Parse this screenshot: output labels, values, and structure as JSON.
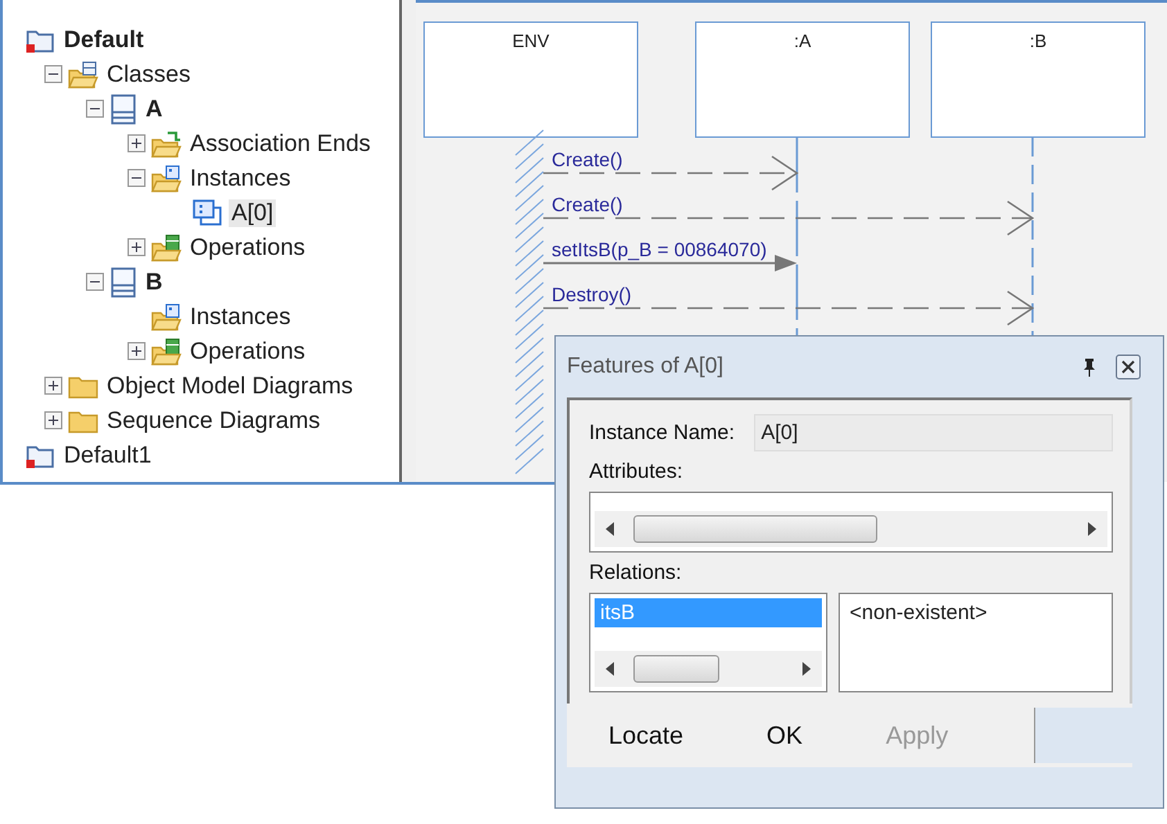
{
  "tree": {
    "items": [
      {
        "label": "Default",
        "kind": "package",
        "bold": true,
        "selected": false,
        "children": [
          {
            "label": "Classes",
            "kind": "classes-folder",
            "bold": false,
            "selected": false,
            "expanded": true,
            "children": [
              {
                "label": "A",
                "kind": "class",
                "bold": true,
                "selected": false,
                "expanded": true,
                "children": [
                  {
                    "label": "Association Ends",
                    "kind": "assoc-folder",
                    "bold": false,
                    "selected": false,
                    "expanded": false
                  },
                  {
                    "label": "Instances",
                    "kind": "instances-folder",
                    "bold": false,
                    "selected": false,
                    "expanded": true,
                    "children": [
                      {
                        "label": "A[0]",
                        "kind": "instance",
                        "bold": false,
                        "selected": true
                      }
                    ]
                  },
                  {
                    "label": "Operations",
                    "kind": "operations-folder",
                    "bold": false,
                    "selected": false,
                    "expanded": false
                  }
                ]
              },
              {
                "label": "B",
                "kind": "class",
                "bold": true,
                "selected": false,
                "expanded": true,
                "children": [
                  {
                    "label": "Instances",
                    "kind": "instances-folder",
                    "bold": false,
                    "selected": false
                  },
                  {
                    "label": "Operations",
                    "kind": "operations-folder",
                    "bold": false,
                    "selected": false,
                    "expanded": false
                  }
                ]
              }
            ]
          },
          {
            "label": "Object Model Diagrams",
            "kind": "folder",
            "bold": false,
            "selected": false,
            "expanded": false
          },
          {
            "label": "Sequence Diagrams",
            "kind": "folder",
            "bold": false,
            "selected": false,
            "expanded": false
          }
        ]
      },
      {
        "label": "Default1",
        "kind": "package",
        "bold": false,
        "selected": false
      }
    ]
  },
  "diagram": {
    "lifelines": [
      {
        "name": "ENV",
        "kind": "environment"
      },
      {
        "name": ":A",
        "kind": "instance"
      },
      {
        "name": ":B",
        "kind": "instance"
      }
    ],
    "messages": [
      {
        "label": "Create()",
        "kind": "async"
      },
      {
        "label": "Create()",
        "kind": "async"
      },
      {
        "label": "setItsB(p_B = 00864070)",
        "kind": "sync"
      },
      {
        "label": "Destroy()",
        "kind": "async"
      }
    ]
  },
  "dialog": {
    "title": "Features of A[0]",
    "instance_name_label": "Instance Name:",
    "instance_name": "A[0]",
    "attributes_label": "Attributes:",
    "relations_label": "Relations:",
    "relations": [
      {
        "label": "itsB",
        "selected": true
      }
    ],
    "relation_targets": [
      "<non-existent>"
    ],
    "buttons": [
      {
        "label": "Locate",
        "disabled": false
      },
      {
        "label": "OK",
        "disabled": false
      },
      {
        "label": "Apply",
        "disabled": true
      }
    ]
  }
}
